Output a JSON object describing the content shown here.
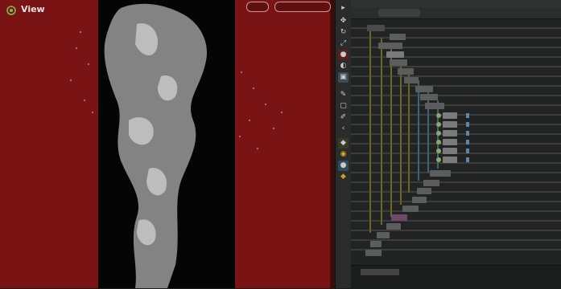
{
  "viewport": {
    "title": "View",
    "pills": [
      "",
      ""
    ]
  },
  "toolbar": {
    "tools": [
      "",
      "",
      "",
      "",
      "",
      "",
      "",
      "",
      "",
      "",
      "",
      "",
      "",
      "",
      "",
      ""
    ]
  },
  "panel": {
    "tab_label": "",
    "tree_label": "",
    "footer_label": ""
  },
  "colors": {
    "viewport_bg": "#7a1414",
    "panel_bg": "#222323",
    "tree_line_yellow": "#b8b21e",
    "tree_line_cyan": "#4bb0cf"
  }
}
